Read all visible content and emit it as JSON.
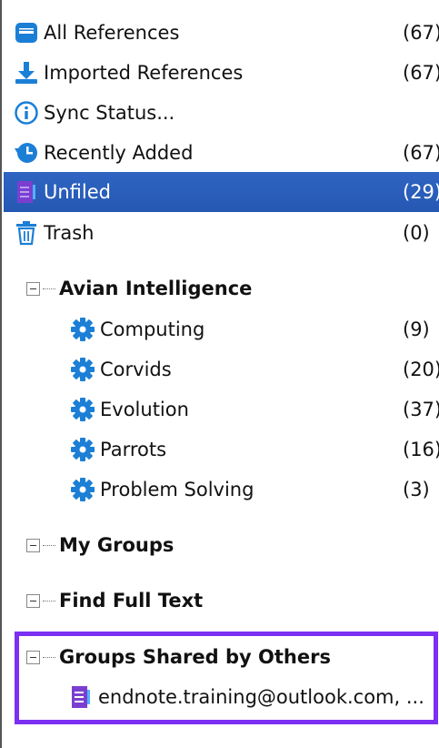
{
  "library": {
    "items": [
      {
        "label": "All References",
        "count": "(67)",
        "icon": "library-icon"
      },
      {
        "label": "Imported References",
        "count": "(67)",
        "icon": "import-icon"
      },
      {
        "label": "Sync Status...",
        "count": "",
        "icon": "info-icon"
      },
      {
        "label": "Recently Added",
        "count": "(67)",
        "icon": "history-icon"
      },
      {
        "label": "Unfiled",
        "count": "(29)",
        "icon": "unfiled-icon"
      },
      {
        "label": "Trash",
        "count": "(0)",
        "icon": "trash-icon"
      }
    ]
  },
  "groups": {
    "avian": {
      "label": "Avian Intelligence",
      "items": [
        {
          "label": "Computing",
          "count": "(9)",
          "icon": "gear-icon"
        },
        {
          "label": "Corvids",
          "count": "(20)",
          "icon": "gear-icon"
        },
        {
          "label": "Evolution",
          "count": "(37)",
          "icon": "gear-icon"
        },
        {
          "label": "Parrots",
          "count": "(16)",
          "icon": "gear-icon"
        },
        {
          "label": "Problem Solving",
          "count": "(3)",
          "icon": "gear-icon"
        }
      ]
    },
    "my_groups": {
      "label": "My Groups"
    },
    "find_full_text": {
      "label": "Find Full Text"
    },
    "shared": {
      "label": "Groups Shared by Others",
      "items": [
        {
          "label": "endnote.training@outlook.com, ...",
          "icon": "shared-group-icon"
        }
      ]
    }
  },
  "colors": {
    "selection": "#2558b3",
    "icon_blue": "#1b7fd6",
    "highlight_border": "#7b2ff2",
    "unfiled_purple": "#7a3fd0"
  }
}
